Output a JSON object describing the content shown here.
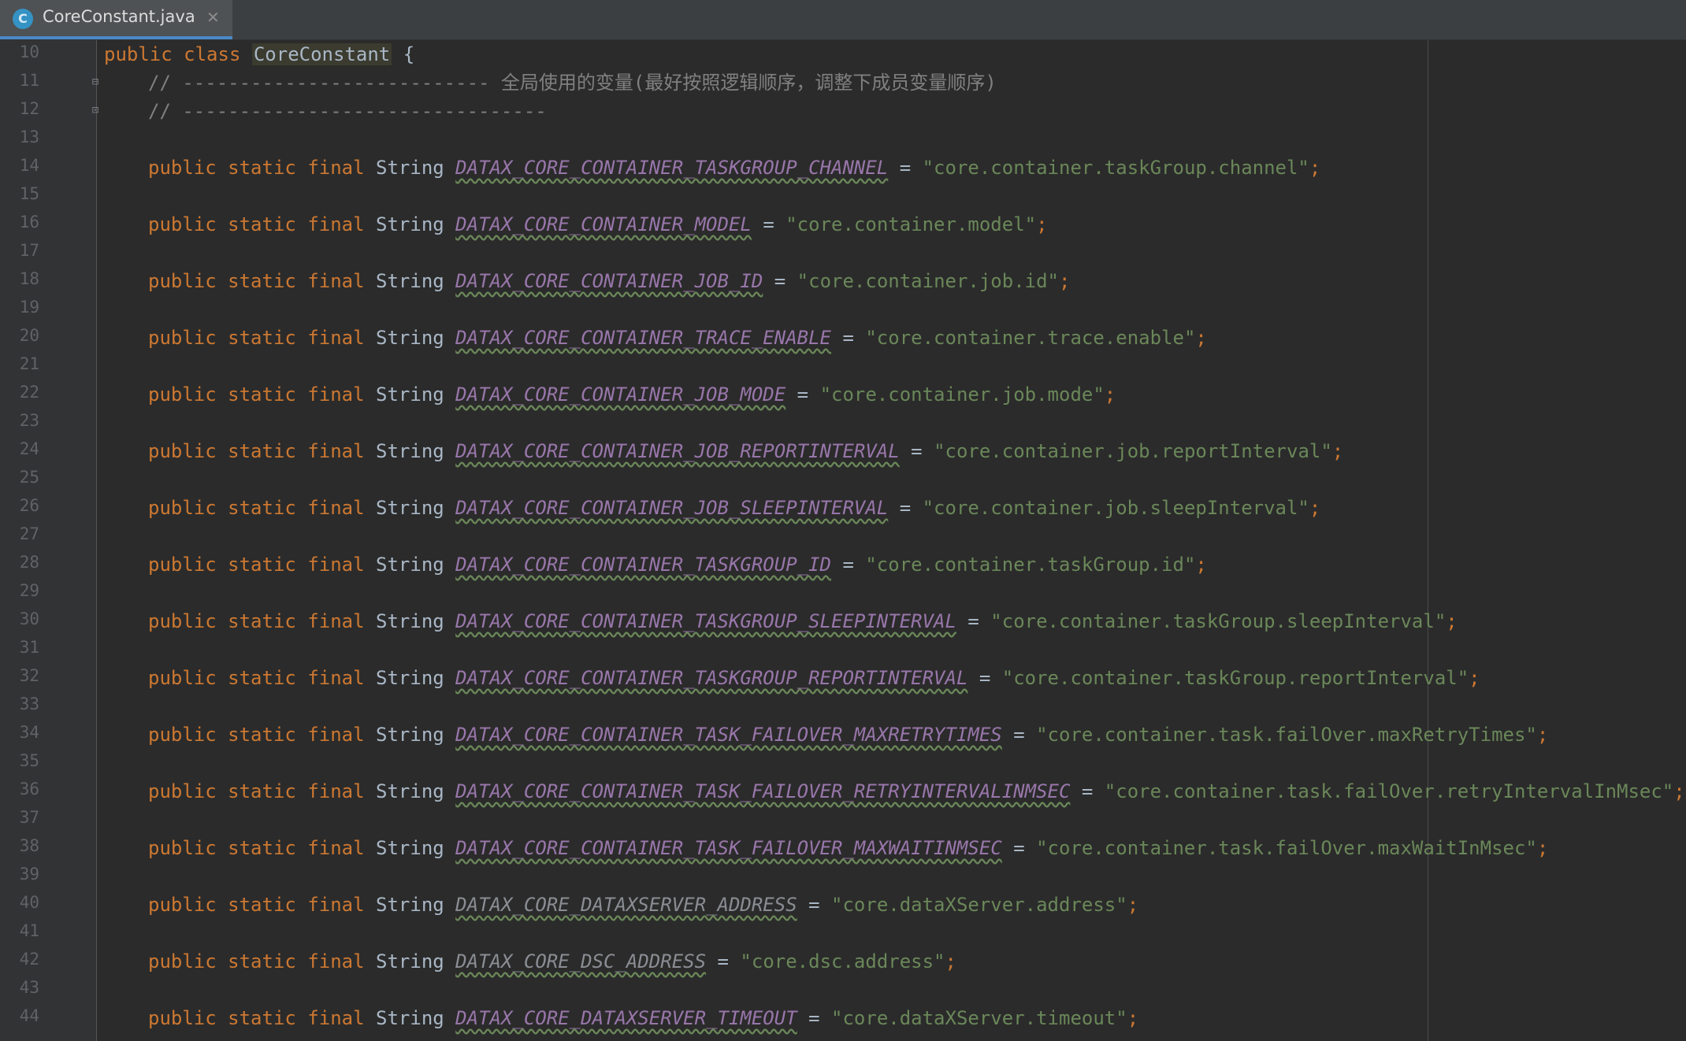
{
  "tab": {
    "file_name": "CoreConstant.java",
    "icon_letter": "C",
    "close_glyph": "✕"
  },
  "class_header": {
    "line": "10",
    "kw1": "public",
    "kw2": "class",
    "name": "CoreConstant",
    "brace": "{"
  },
  "comment_lines": [
    {
      "line": "11",
      "text": "// --------------------------- 全局使用的变量(最好按照逻辑顺序，调整下成员变量顺序)"
    },
    {
      "line": "12",
      "text": "// --------------------------------"
    }
  ],
  "modifiers": {
    "public": "public",
    "static": "static",
    "final": "final",
    "type": "String",
    "eq": "=",
    "semi": ";"
  },
  "blank_lines": [
    "13",
    "15",
    "17",
    "19",
    "21",
    "23",
    "25",
    "27",
    "29",
    "31",
    "33",
    "35",
    "37",
    "39",
    "41",
    "43"
  ],
  "constants": [
    {
      "line": "14",
      "name": "DATAX_CORE_CONTAINER_TASKGROUP_CHANNEL",
      "value": "\"core.container.taskGroup.channel\"",
      "used": true
    },
    {
      "line": "16",
      "name": "DATAX_CORE_CONTAINER_MODEL",
      "value": "\"core.container.model\"",
      "used": true
    },
    {
      "line": "18",
      "name": "DATAX_CORE_CONTAINER_JOB_ID",
      "value": "\"core.container.job.id\"",
      "used": true
    },
    {
      "line": "20",
      "name": "DATAX_CORE_CONTAINER_TRACE_ENABLE",
      "value": "\"core.container.trace.enable\"",
      "used": true
    },
    {
      "line": "22",
      "name": "DATAX_CORE_CONTAINER_JOB_MODE",
      "value": "\"core.container.job.mode\"",
      "used": true
    },
    {
      "line": "24",
      "name": "DATAX_CORE_CONTAINER_JOB_REPORTINTERVAL",
      "value": "\"core.container.job.reportInterval\"",
      "used": true
    },
    {
      "line": "26",
      "name": "DATAX_CORE_CONTAINER_JOB_SLEEPINTERVAL",
      "value": "\"core.container.job.sleepInterval\"",
      "used": true
    },
    {
      "line": "28",
      "name": "DATAX_CORE_CONTAINER_TASKGROUP_ID",
      "value": "\"core.container.taskGroup.id\"",
      "used": true
    },
    {
      "line": "30",
      "name": "DATAX_CORE_CONTAINER_TASKGROUP_SLEEPINTERVAL",
      "value": "\"core.container.taskGroup.sleepInterval\"",
      "used": true
    },
    {
      "line": "32",
      "name": "DATAX_CORE_CONTAINER_TASKGROUP_REPORTINTERVAL",
      "value": "\"core.container.taskGroup.reportInterval\"",
      "used": true
    },
    {
      "line": "34",
      "name": "DATAX_CORE_CONTAINER_TASK_FAILOVER_MAXRETRYTIMES",
      "value": "\"core.container.task.failOver.maxRetryTimes\"",
      "used": true
    },
    {
      "line": "36",
      "name": "DATAX_CORE_CONTAINER_TASK_FAILOVER_RETRYINTERVALINMSEC",
      "value": "\"core.container.task.failOver.retryIntervalInMsec\"",
      "used": true
    },
    {
      "line": "38",
      "name": "DATAX_CORE_CONTAINER_TASK_FAILOVER_MAXWAITINMSEC",
      "value": "\"core.container.task.failOver.maxWaitInMsec\"",
      "used": true
    },
    {
      "line": "40",
      "name": "DATAX_CORE_DATAXSERVER_ADDRESS",
      "value": "\"core.dataXServer.address\"",
      "used": false
    },
    {
      "line": "42",
      "name": "DATAX_CORE_DSC_ADDRESS",
      "value": "\"core.dsc.address\"",
      "used": false
    },
    {
      "line": "44",
      "name": "DATAX_CORE_DATAXSERVER_TIMEOUT",
      "value": "\"core.dataXServer.timeout\"",
      "used": true
    }
  ]
}
